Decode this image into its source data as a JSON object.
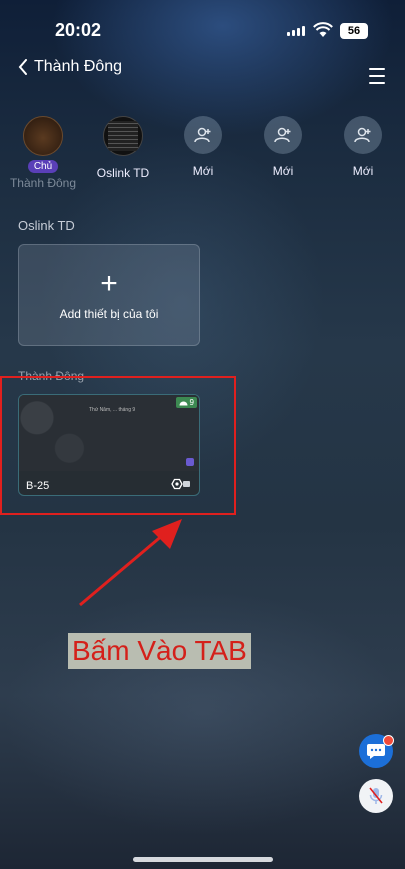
{
  "status_bar": {
    "time": "20:02",
    "battery": "56"
  },
  "header": {
    "back_label": "Thành Đông"
  },
  "members": [
    {
      "label": "Thành Đông",
      "badge": "Chủ"
    },
    {
      "label": "Oslink TD"
    },
    {
      "label": "Mới"
    },
    {
      "label": "Mới"
    },
    {
      "label": "Mới"
    }
  ],
  "sections": {
    "oslink": {
      "title": "Oslink TD",
      "add_card_label": "Add thiết bị của tôi",
      "add_symbol": "+"
    },
    "thanh_dong": {
      "title": "Thành Đông",
      "device": {
        "name": "B-25",
        "status": "9",
        "preview_text": "Thứ Năm, ... tháng 9"
      }
    }
  },
  "annotation": {
    "caption": "Bấm Vào TAB"
  },
  "colors": {
    "highlight": "#e0201e",
    "chat_button": "#1c6fd8",
    "owner_badge": "#5a3fb8",
    "online_tag": "#3d8a52"
  }
}
